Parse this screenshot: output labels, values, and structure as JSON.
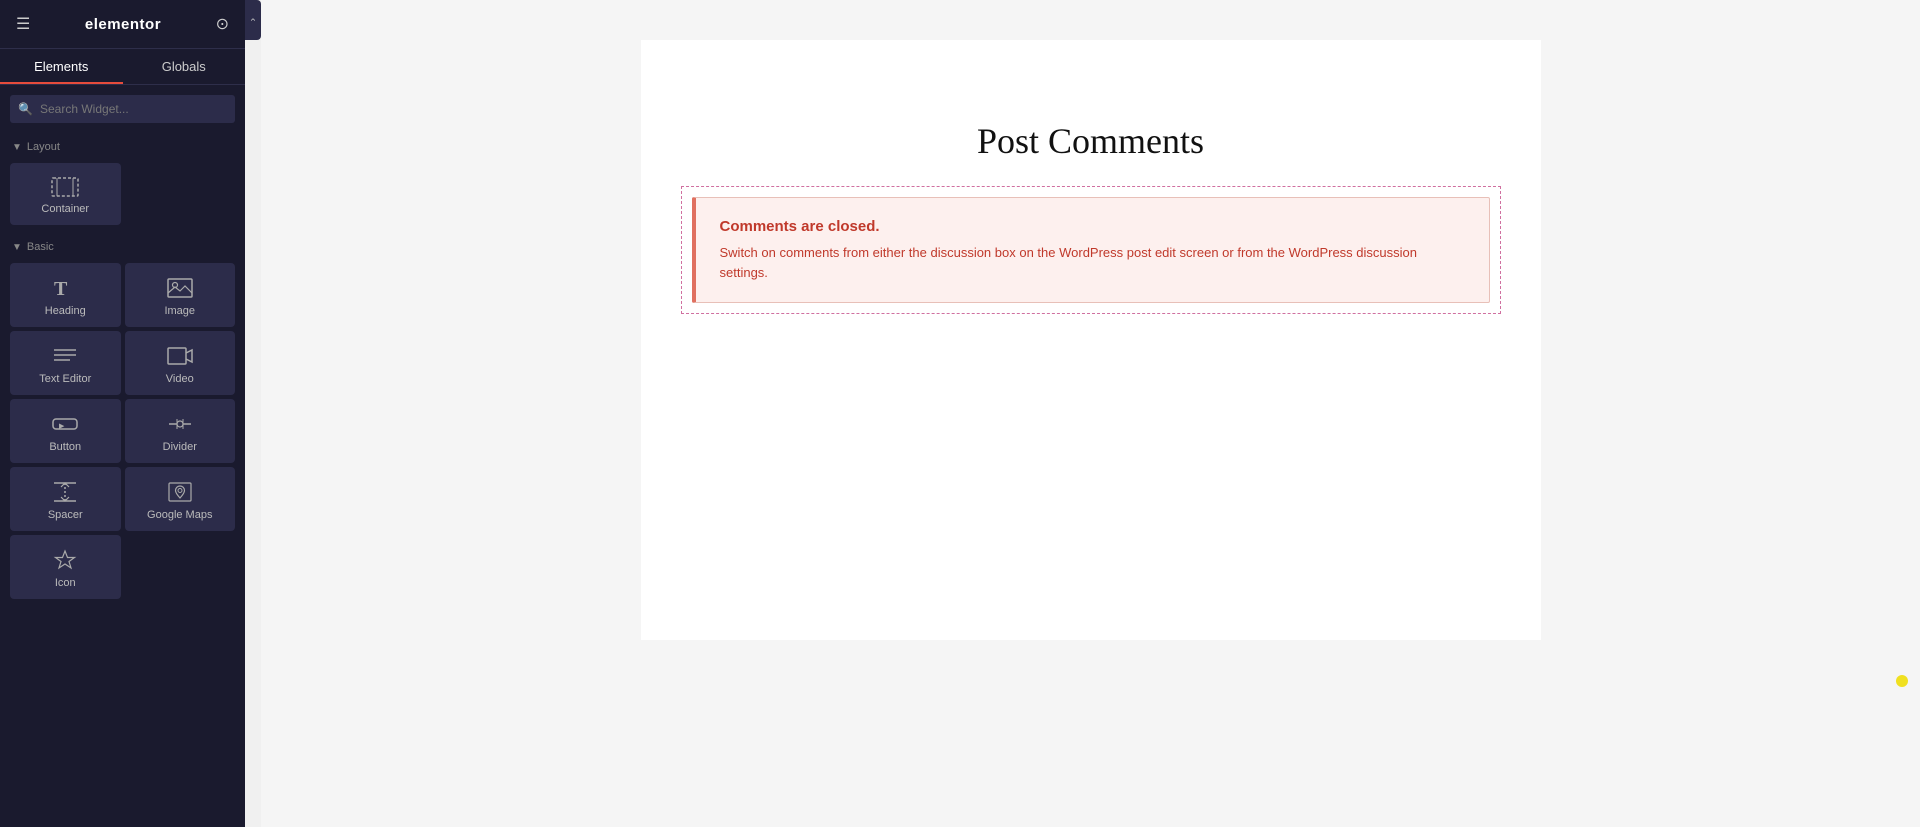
{
  "sidebar": {
    "logo": "elementor",
    "hamburger_icon": "≡",
    "grid_icon": "⊞",
    "tabs": [
      {
        "id": "elements",
        "label": "Elements",
        "active": true
      },
      {
        "id": "globals",
        "label": "Globals",
        "active": false
      }
    ],
    "search": {
      "placeholder": "Search Widget..."
    },
    "sections": [
      {
        "id": "layout",
        "label": "Layout",
        "collapsed": false,
        "widgets": [
          {
            "id": "container",
            "label": "Container",
            "icon": "container"
          }
        ]
      },
      {
        "id": "basic",
        "label": "Basic",
        "collapsed": false,
        "widgets": [
          {
            "id": "heading",
            "label": "Heading",
            "icon": "heading"
          },
          {
            "id": "image",
            "label": "Image",
            "icon": "image"
          },
          {
            "id": "text-editor",
            "label": "Text Editor",
            "icon": "text-editor"
          },
          {
            "id": "video",
            "label": "Video",
            "icon": "video"
          },
          {
            "id": "button",
            "label": "Button",
            "icon": "button"
          },
          {
            "id": "divider",
            "label": "Divider",
            "icon": "divider"
          },
          {
            "id": "spacer",
            "label": "Spacer",
            "icon": "spacer"
          },
          {
            "id": "google-maps",
            "label": "Google Maps",
            "icon": "google-maps"
          },
          {
            "id": "icon",
            "label": "Icon",
            "icon": "icon"
          }
        ]
      }
    ]
  },
  "canvas": {
    "post_comments_title": "Post Comments",
    "comments_closed": {
      "title": "Comments are closed.",
      "description": "Switch on comments from either the discussion box on the WordPress post edit screen or from the WordPress discussion settings."
    }
  }
}
